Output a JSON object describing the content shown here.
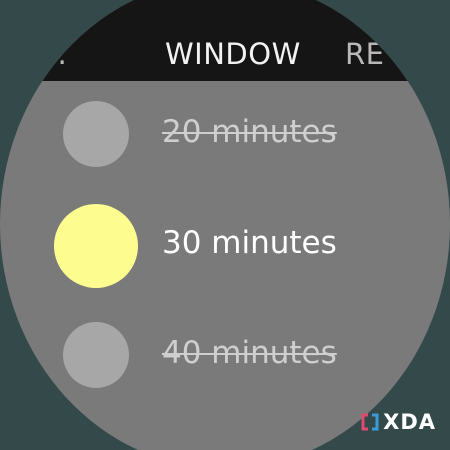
{
  "tabs": {
    "previous": "…",
    "current": "WINDOW",
    "next": "RE"
  },
  "options": [
    {
      "label": "20 minutes",
      "state": "disabled",
      "color": "#a7a7a7"
    },
    {
      "label": "30 minutes",
      "state": "selected",
      "color": "#fdfd8f"
    },
    {
      "label": "40 minutes",
      "state": "disabled",
      "color": "#a7a7a7"
    }
  ],
  "watermark": {
    "text": "XDA",
    "icon": "xda-logo-icon",
    "accent_left": "#e04a6e",
    "accent_right": "#3a9bd6"
  },
  "colors": {
    "background": "#344a4a",
    "watch_face": "#7a7a7a",
    "topbar": "#151515"
  }
}
